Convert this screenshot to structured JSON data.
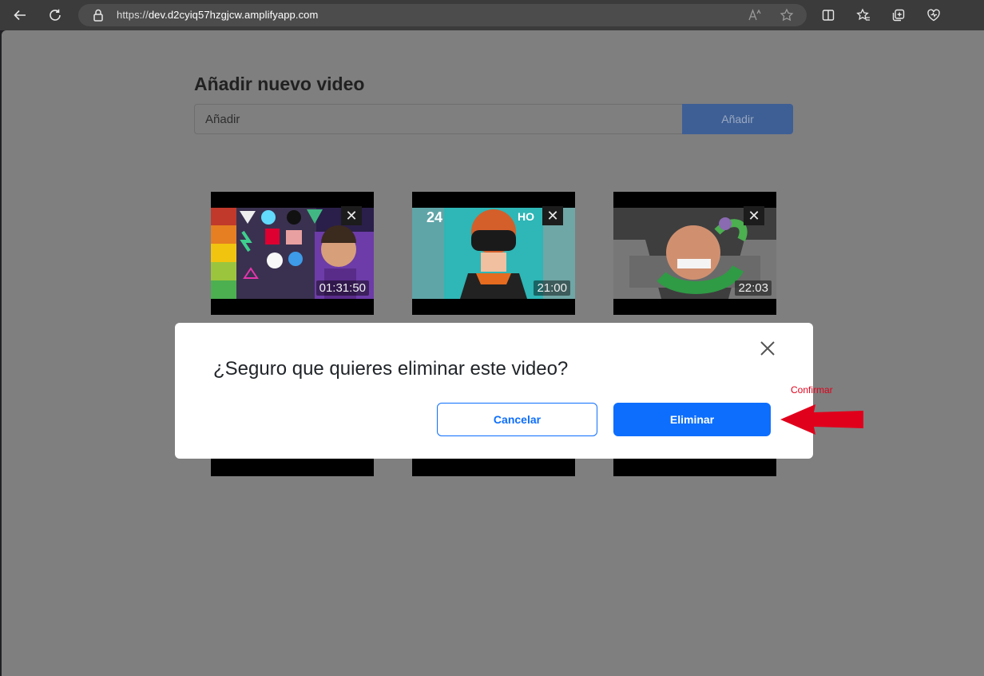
{
  "browser": {
    "url_prefix": "https://",
    "url_domain": "dev.d2cyiq57hzgjcw.amplifyapp.com"
  },
  "page": {
    "title": "Añadir nuevo video",
    "input_placeholder": "Añadir",
    "add_button": "Añadir"
  },
  "videos": [
    {
      "duration": "01:31:50"
    },
    {
      "duration": "21:00"
    },
    {
      "duration": "22:03"
    }
  ],
  "modal": {
    "question": "¿Seguro que quieres eliminar este video?",
    "cancel": "Cancelar",
    "delete": "Eliminar"
  },
  "annotation": {
    "text": "Confirmar",
    "color": "#e0001b"
  },
  "colors": {
    "primary": "#0d6efd",
    "overlay": "#7f7f7f"
  }
}
